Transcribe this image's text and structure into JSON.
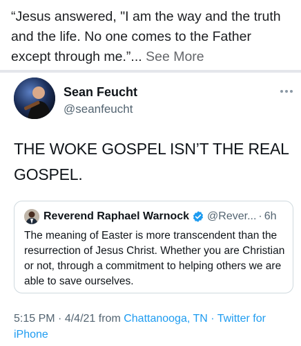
{
  "caption": {
    "text": "“Jesus answered, \"I am the way and the truth and the life. No one comes to the Father except through me.”...",
    "see_more": "See More"
  },
  "tweet": {
    "author_name": "Sean Feucht",
    "author_handle": "@seanfeucht",
    "more_icon": "more-horizontal-icon",
    "text": "THE WOKE GOSPEL ISN’T THE REAL GOSPEL."
  },
  "quote": {
    "author_name": "Reverend Raphael Warnock",
    "verified_icon": "verified-badge-icon",
    "author_handle": "@Rever...",
    "dot": "·",
    "time": "6h",
    "text": "The meaning of Easter is more transcendent than the resurrection of Jesus Christ. Whether you are Christian or not, through a commitment to helping others we are able to save ourselves."
  },
  "meta": {
    "time": "5:15 PM",
    "sep1": "·",
    "date": "4/4/21",
    "from_label": "from",
    "location": "Chattanooga, TN",
    "sep2": "·",
    "client": "Twitter for iPhone"
  },
  "colors": {
    "link_blue": "#1d9bf0",
    "verified_blue": "#1d9bf0",
    "secondary_text": "#536471",
    "divider": "#e4e6eb"
  }
}
